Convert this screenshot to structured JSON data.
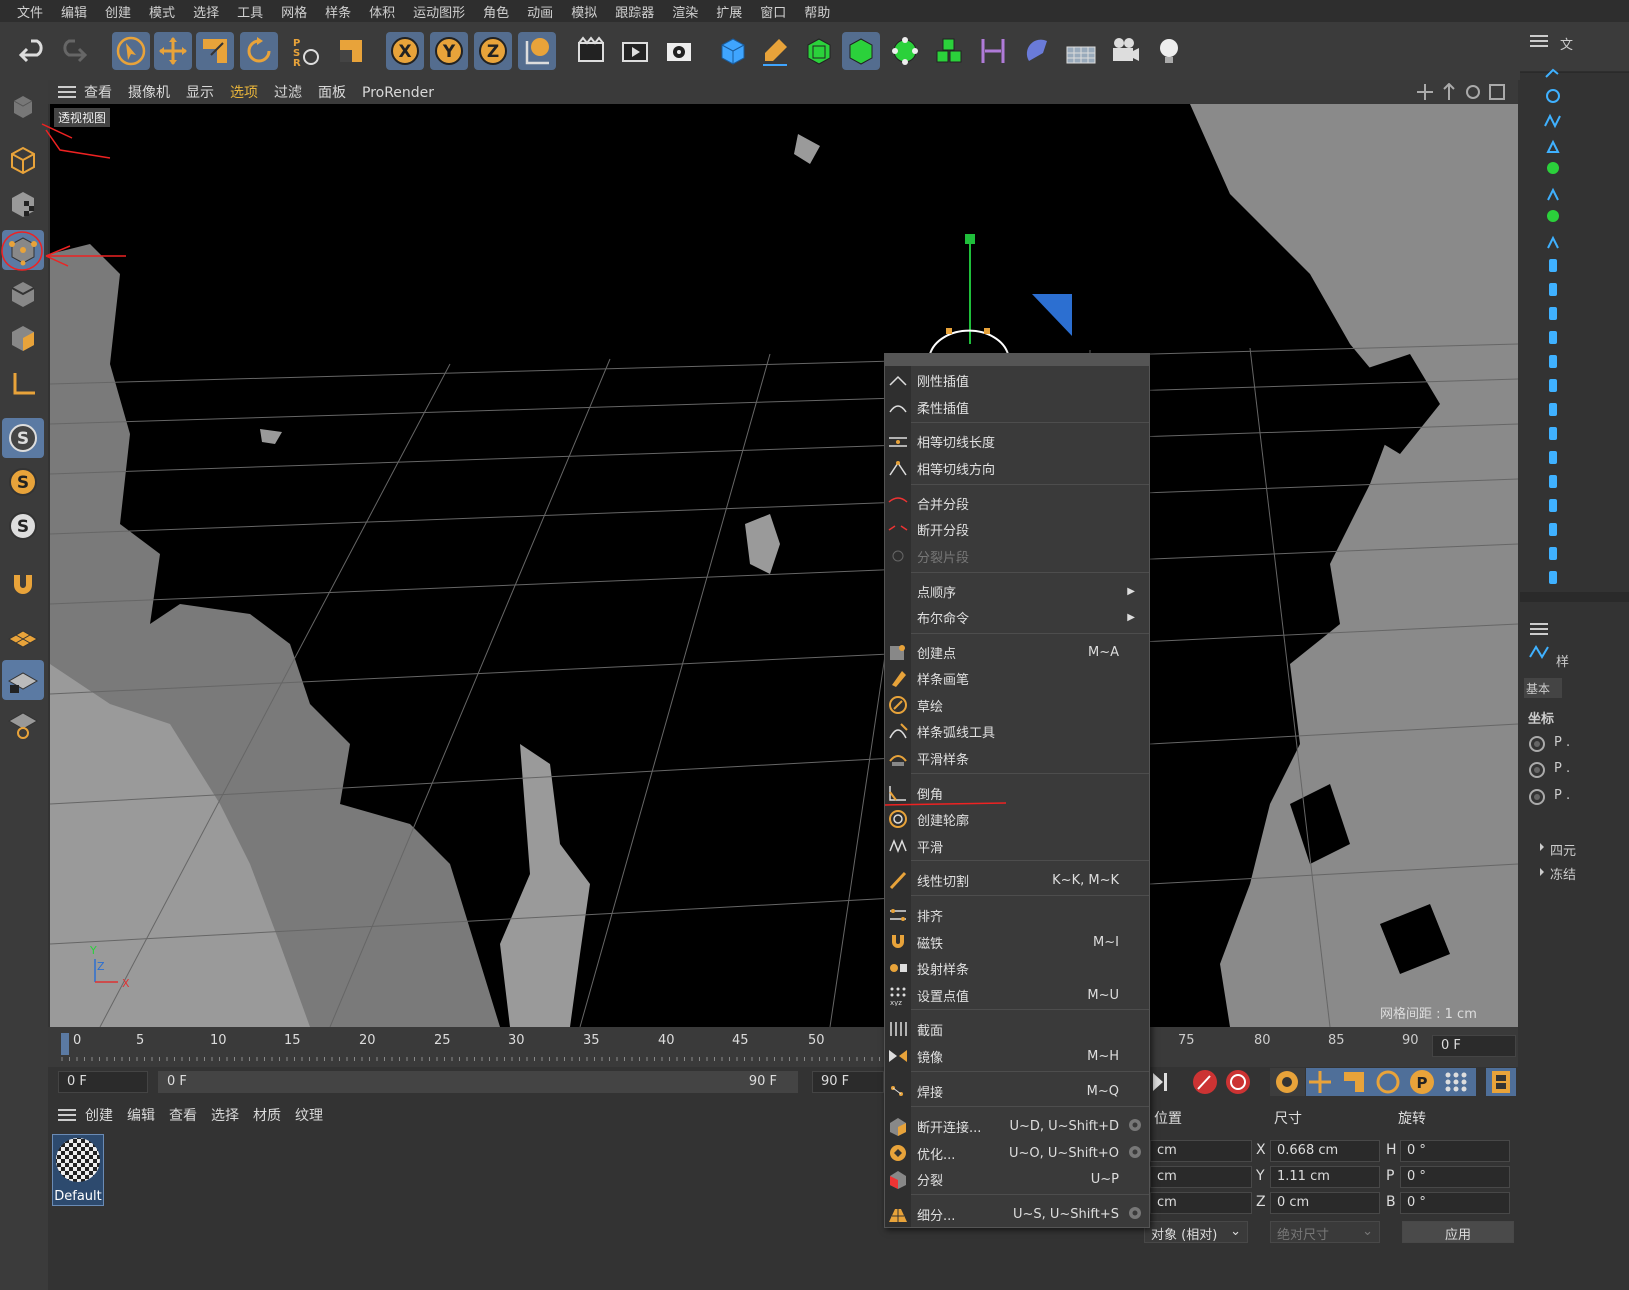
{
  "menubar": [
    "文件",
    "编辑",
    "创建",
    "模式",
    "选择",
    "工具",
    "网格",
    "样条",
    "体积",
    "运动图形",
    "角色",
    "动画",
    "模拟",
    "跟踪器",
    "渲染",
    "扩展",
    "窗口",
    "帮助"
  ],
  "toolbar_icons": [
    "undo-icon",
    "redo-icon",
    "live-select-icon",
    "move-icon",
    "scale-icon",
    "rotate-icon",
    "psr-icon",
    "last-tool-icon",
    "x-axis-icon",
    "y-axis-icon",
    "z-axis-icon",
    "world-coord-icon",
    "render-region-icon",
    "render-view-icon",
    "render-settings-icon",
    "cube-icon",
    "pen-icon",
    "subdivision-icon",
    "extrude-icon",
    "mograph-icon",
    "cloner-icon",
    "deformer-icon",
    "field-icon",
    "floor-icon",
    "camera-icon",
    "light-icon"
  ],
  "viewport": {
    "menu": [
      "查看",
      "摄像机",
      "显示",
      "选项",
      "过滤",
      "面板",
      "ProRender"
    ],
    "active_menu": "选项",
    "label": "透视视图",
    "grid_spacing": "网格间距 : 1 cm"
  },
  "timeline": {
    "ticks": [
      "0",
      "5",
      "10",
      "15",
      "20",
      "25",
      "30",
      "35",
      "40",
      "45",
      "50",
      "75",
      "80",
      "85",
      "90"
    ],
    "start_frame": "0 F",
    "range_start": "0 F",
    "range_end": "90 F",
    "end_frame": "90 F",
    "current": "0 F"
  },
  "material_panel": {
    "menu": [
      "创建",
      "编辑",
      "查看",
      "选择",
      "材质",
      "纹理"
    ],
    "material_name": "Default"
  },
  "coordinates": {
    "headers": [
      "位置",
      "尺寸",
      "旋转"
    ],
    "rows": [
      {
        "pos_unit": "cm",
        "size_axis": "X",
        "size": "0.668 cm",
        "rot_axis": "H",
        "rot": "0 °"
      },
      {
        "pos_unit": "cm",
        "size_axis": "Y",
        "size": "1.11 cm",
        "rot_axis": "P",
        "rot": "0 °"
      },
      {
        "pos_unit": "cm",
        "size_axis": "Z",
        "size": "0 cm",
        "rot_axis": "B",
        "rot": "0 °"
      }
    ],
    "mode_select": "对象 (相对)",
    "size_select": "绝对尺寸",
    "apply": "应用"
  },
  "right_panel": {
    "tab1": "文",
    "attr_tab": "样",
    "basic": "基本",
    "coord_label": "坐标",
    "p_items": [
      "P .",
      "P .",
      "P ."
    ],
    "expand1": "四元",
    "expand2": "冻结"
  },
  "context_menu": {
    "items": [
      {
        "label": "刚性插值",
        "shortcut": "",
        "icon": "hard-interp-icon"
      },
      {
        "label": "柔性插值",
        "shortcut": "",
        "icon": "soft-interp-icon"
      },
      {
        "label": "相等切线长度",
        "shortcut": "",
        "icon": "equal-tangent-length-icon"
      },
      {
        "label": "相等切线方向",
        "shortcut": "",
        "icon": "equal-tangent-direction-icon"
      },
      {
        "label": "合并分段",
        "shortcut": "",
        "icon": "join-segment-icon"
      },
      {
        "label": "断开分段",
        "shortcut": "",
        "icon": "break-segment-icon"
      },
      {
        "label": "分裂片段",
        "shortcut": "",
        "icon": "explode-segments-icon",
        "disabled": true
      },
      {
        "label": "点顺序",
        "shortcut": "",
        "icon": "",
        "submenu": true
      },
      {
        "label": "布尔命令",
        "shortcut": "",
        "icon": "",
        "submenu": true
      },
      {
        "label": "创建点",
        "shortcut": "M~A",
        "icon": "create-point-icon"
      },
      {
        "label": "样条画笔",
        "shortcut": "",
        "icon": "spline-pen-icon"
      },
      {
        "label": "草绘",
        "shortcut": "",
        "icon": "sketch-icon"
      },
      {
        "label": "样条弧线工具",
        "shortcut": "",
        "icon": "spline-arc-icon"
      },
      {
        "label": "平滑样条",
        "shortcut": "",
        "icon": "spline-smooth-icon"
      },
      {
        "label": "倒角",
        "shortcut": "",
        "icon": "chamfer-icon"
      },
      {
        "label": "创建轮廓",
        "shortcut": "",
        "icon": "create-outline-icon"
      },
      {
        "label": "平滑",
        "shortcut": "",
        "icon": "smooth-icon"
      },
      {
        "label": "线性切割",
        "shortcut": "K~K, M~K",
        "icon": "knife-icon"
      },
      {
        "label": "排齐",
        "shortcut": "",
        "icon": "line-up-icon"
      },
      {
        "label": "磁铁",
        "shortcut": "M~I",
        "icon": "magnet-icon"
      },
      {
        "label": "投射样条",
        "shortcut": "",
        "icon": "project-spline-icon"
      },
      {
        "label": "设置点值",
        "shortcut": "M~U",
        "icon": "set-point-value-icon"
      },
      {
        "label": "截面",
        "shortcut": "",
        "icon": "cross-section-icon"
      },
      {
        "label": "镜像",
        "shortcut": "M~H",
        "icon": "mirror-icon"
      },
      {
        "label": "焊接",
        "shortcut": "M~Q",
        "icon": "weld-icon"
      },
      {
        "label": "断开连接...",
        "shortcut": "U~D, U~Shift+D",
        "icon": "disconnect-icon",
        "gear": true
      },
      {
        "label": "优化...",
        "shortcut": "U~O, U~Shift+O",
        "icon": "optimize-icon",
        "gear": true
      },
      {
        "label": "分裂",
        "shortcut": "U~P",
        "icon": "split-icon"
      },
      {
        "label": "细分...",
        "shortcut": "U~S, U~Shift+S",
        "icon": "subdivide-icon",
        "gear": true
      }
    ]
  }
}
